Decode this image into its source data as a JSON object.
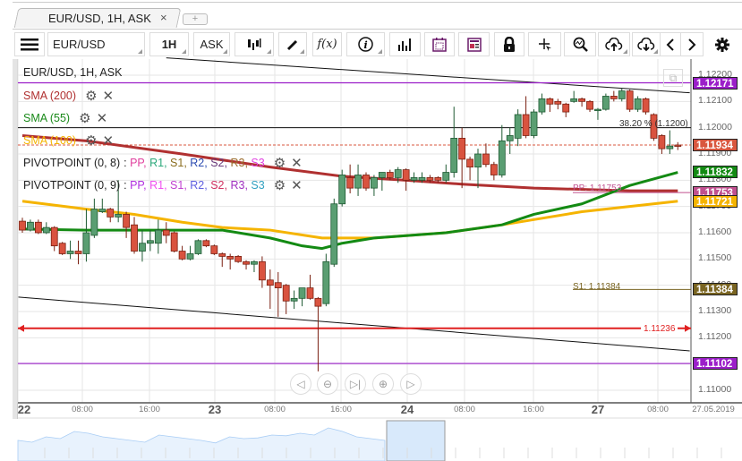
{
  "tab": {
    "title": "EUR/USD, 1H, ASK",
    "close": "×",
    "add": "+"
  },
  "toolbar": {
    "symbol": "EUR/USD",
    "timeframe": "1H",
    "price_type": "ASK",
    "fx": "f(x)",
    "icons": [
      "menu-icon",
      "candlestick-icon",
      "pencil-icon",
      "function-icon",
      "info-icon",
      "bar-chart-icon",
      "calendar-icon",
      "news-icon",
      "lock-icon",
      "crosshair-icon",
      "zoom-chart-icon",
      "upload-icon",
      "download-icon",
      "chevron-left-icon",
      "chevron-right-icon",
      "gear-icon"
    ]
  },
  "legend": {
    "title": "EUR/USD, 1H, ASK",
    "sma200": {
      "label": "SMA (200)",
      "color": "#b03030"
    },
    "sma55": {
      "label": "SMA (55)",
      "color": "#1a8a1a"
    },
    "sma100": {
      "label": "SMA (100)",
      "color": "#f5b400"
    },
    "pivot8": {
      "label": "PIVOTPOINT (0, 8)",
      "items": [
        {
          "t": "PP",
          "c": "#e0409e"
        },
        {
          "t": "R1",
          "c": "#2aa87a"
        },
        {
          "t": "S1",
          "c": "#8a6d1e"
        },
        {
          "t": "R2",
          "c": "#2a4ab0"
        },
        {
          "t": "S2",
          "c": "#6a3a7a"
        },
        {
          "t": "R3",
          "c": "#9a6a2a"
        },
        {
          "t": "S3",
          "c": "#e040e0"
        }
      ]
    },
    "pivot9": {
      "label": "PIVOTPOINT (0, 9)",
      "items": [
        {
          "t": "PP",
          "c": "#b030e0"
        },
        {
          "t": "R1",
          "c": "#f050f0"
        },
        {
          "t": "S1",
          "c": "#c040d0"
        },
        {
          "t": "R2",
          "c": "#6060e0"
        },
        {
          "t": "S2",
          "c": "#d03060"
        },
        {
          "t": "R3",
          "c": "#a030c0"
        },
        {
          "t": "S3",
          "c": "#30a0c0"
        }
      ]
    }
  },
  "price_axis": [
    "1.12200",
    "1.12100",
    "1.12000",
    "1.11900",
    "1.11800",
    "1.11700",
    "1.11600",
    "1.11500",
    "1.11400",
    "1.11300",
    "1.11200",
    "1.11100",
    "1.11000"
  ],
  "price_labels": [
    {
      "value": "1.12171",
      "color": "#9b1fc9"
    },
    {
      "value": "1.11934",
      "color": "#d9573f"
    },
    {
      "value": "1.11832",
      "color": "#138a13"
    },
    {
      "value": "1.11753",
      "color": "#c0508f"
    },
    {
      "value": "1.11721",
      "color": "#f5b400"
    },
    {
      "value": "1.11384",
      "color": "#7a6522"
    },
    {
      "value": "1.11102",
      "color": "#9b1fc9"
    }
  ],
  "annotations": {
    "fib": "38.20 % (1.1200)",
    "fib_price": 1.12,
    "pp": "PP: 1.11753",
    "s1": "S1: 1.11384",
    "alert": "1.11236",
    "alert_price": 1.11236,
    "last_price": 1.11934
  },
  "time_axis": {
    "labels": [
      "22",
      "08:00",
      "16:00",
      "23",
      "08:00",
      "16:00",
      "24",
      "08:00",
      "16:00",
      "27",
      "08:00"
    ],
    "date": "27.05.2019"
  },
  "colors": {
    "bull": "#5a9e72",
    "bear": "#d9533f"
  },
  "chart_data": {
    "type": "candlestick",
    "symbol": "EUR/USD",
    "interval": "1H",
    "ylim": [
      1.1095,
      1.1228
    ],
    "ohlc": [
      [
        1.11644,
        1.11657,
        1.116,
        1.1161
      ],
      [
        1.1161,
        1.1165,
        1.11605,
        1.1164
      ],
      [
        1.1164,
        1.1165,
        1.11595,
        1.116
      ],
      [
        1.116,
        1.1164,
        1.11595,
        1.1162
      ],
      [
        1.1162,
        1.11625,
        1.1153,
        1.1155
      ],
      [
        1.1156,
        1.11565,
        1.11515,
        1.1152
      ],
      [
        1.1152,
        1.1157,
        1.115,
        1.1153
      ],
      [
        1.1153,
        1.1157,
        1.1148,
        1.1152
      ],
      [
        1.1152,
        1.1169,
        1.1149,
        1.116
      ],
      [
        1.1159,
        1.1173,
        1.1158,
        1.1169
      ],
      [
        1.1168,
        1.1173,
        1.11675,
        1.1169
      ],
      [
        1.1169,
        1.11695,
        1.1164,
        1.1166
      ],
      [
        1.1166,
        1.118,
        1.1164,
        1.1167
      ],
      [
        1.1167,
        1.1168,
        1.1158,
        1.1162
      ],
      [
        1.1163,
        1.1166,
        1.1152,
        1.1153
      ],
      [
        1.1153,
        1.1161,
        1.1149,
        1.1156
      ],
      [
        1.1156,
        1.1161,
        1.1153,
        1.1157
      ],
      [
        1.1156,
        1.1165,
        1.1152,
        1.1161
      ],
      [
        1.1161,
        1.1164,
        1.1156,
        1.1159
      ],
      [
        1.116,
        1.11605,
        1.11525,
        1.1153
      ],
      [
        1.1153,
        1.1155,
        1.11495,
        1.115
      ],
      [
        1.115,
        1.1155,
        1.11495,
        1.1152
      ],
      [
        1.1152,
        1.11575,
        1.11515,
        1.1157
      ],
      [
        1.1157,
        1.11575,
        1.11545,
        1.1155
      ],
      [
        1.1155,
        1.11555,
        1.11515,
        1.1152
      ],
      [
        1.1152,
        1.11525,
        1.1147,
        1.1151
      ],
      [
        1.1151,
        1.1152,
        1.1146,
        1.115
      ],
      [
        1.1151,
        1.11515,
        1.11485,
        1.1149
      ],
      [
        1.1149,
        1.11495,
        1.1146,
        1.1148
      ],
      [
        1.1148,
        1.11495,
        1.1145,
        1.1149
      ],
      [
        1.1149,
        1.1151,
        1.1139,
        1.1142
      ],
      [
        1.1142,
        1.1146,
        1.1131,
        1.114
      ],
      [
        1.1141,
        1.1145,
        1.1128,
        1.1139
      ],
      [
        1.114,
        1.11405,
        1.1129,
        1.1134
      ],
      [
        1.1134,
        1.1138,
        1.1131,
        1.1135
      ],
      [
        1.1135,
        1.1139,
        1.1132,
        1.1139
      ],
      [
        1.1139,
        1.1144,
        1.11345,
        1.1135
      ],
      [
        1.1135,
        1.11355,
        1.11072,
        1.1132
      ],
      [
        1.1133,
        1.1152,
        1.1132,
        1.1149
      ],
      [
        1.1148,
        1.1173,
        1.1147,
        1.1171
      ],
      [
        1.1171,
        1.1184,
        1.117,
        1.1182
      ],
      [
        1.1181,
        1.1186,
        1.1175,
        1.1177
      ],
      [
        1.1177,
        1.1186,
        1.1174,
        1.1182
      ],
      [
        1.1182,
        1.1183,
        1.1176,
        1.1177
      ],
      [
        1.1177,
        1.1182,
        1.1174,
        1.1181
      ],
      [
        1.1181,
        1.1183,
        1.1176,
        1.1183
      ],
      [
        1.1183,
        1.1184,
        1.118,
        1.1181
      ],
      [
        1.1181,
        1.1185,
        1.1179,
        1.1184
      ],
      [
        1.1184,
        1.11845,
        1.1176,
        1.118
      ],
      [
        1.118,
        1.1183,
        1.1179,
        1.1181
      ],
      [
        1.118,
        1.1183,
        1.1179,
        1.1181
      ],
      [
        1.1181,
        1.1182,
        1.1179,
        1.118
      ],
      [
        1.1181,
        1.11815,
        1.1179,
        1.118
      ],
      [
        1.118,
        1.1186,
        1.1179,
        1.1183
      ],
      [
        1.1183,
        1.1208,
        1.1181,
        1.1196
      ],
      [
        1.1196,
        1.12,
        1.1177,
        1.1188
      ],
      [
        1.1188,
        1.1189,
        1.118,
        1.1185
      ],
      [
        1.1185,
        1.1192,
        1.1177,
        1.119
      ],
      [
        1.119,
        1.1194,
        1.1185,
        1.1186
      ],
      [
        1.1186,
        1.1187,
        1.118,
        1.1182
      ],
      [
        1.1182,
        1.1201,
        1.1181,
        1.1195
      ],
      [
        1.1195,
        1.12,
        1.119,
        1.1197
      ],
      [
        1.1196,
        1.1207,
        1.1193,
        1.1205
      ],
      [
        1.1205,
        1.1212,
        1.1196,
        1.1197
      ],
      [
        1.1197,
        1.1207,
        1.1196,
        1.1206
      ],
      [
        1.1206,
        1.1213,
        1.1205,
        1.1211
      ],
      [
        1.1211,
        1.12115,
        1.1206,
        1.1209
      ],
      [
        1.121,
        1.1211,
        1.1207,
        1.1209
      ],
      [
        1.1209,
        1.12095,
        1.1204,
        1.1206
      ],
      [
        1.121,
        1.1214,
        1.12095,
        1.1211
      ],
      [
        1.1211,
        1.12115,
        1.1208,
        1.121
      ],
      [
        1.121,
        1.12105,
        1.1206,
        1.1207
      ],
      [
        1.1207,
        1.12075,
        1.1203,
        1.1207
      ],
      [
        1.1207,
        1.1213,
        1.12065,
        1.1212
      ],
      [
        1.1212,
        1.1214,
        1.121,
        1.1211
      ],
      [
        1.1211,
        1.1215,
        1.121,
        1.1214
      ],
      [
        1.1214,
        1.12145,
        1.1206,
        1.1207
      ],
      [
        1.1207,
        1.1212,
        1.1206,
        1.1211
      ],
      [
        1.1211,
        1.12115,
        1.1205,
        1.1206
      ],
      [
        1.1205,
        1.12055,
        1.1195,
        1.1196
      ],
      [
        1.1197,
        1.11975,
        1.119,
        1.1192
      ],
      [
        1.1192,
        1.1199,
        1.119,
        1.1193
      ],
      [
        1.11934,
        1.11945,
        1.11915,
        1.1193
      ]
    ],
    "sma200": [
      [
        0,
        1.1197
      ],
      [
        8,
        1.1195
      ],
      [
        20,
        1.119
      ],
      [
        31,
        1.1185
      ],
      [
        40,
        1.11815
      ],
      [
        48,
        1.118
      ],
      [
        55,
        1.11785
      ],
      [
        64,
        1.1177
      ],
      [
        76,
        1.1176
      ],
      [
        82,
        1.1176
      ]
    ],
    "sma55": [
      [
        0,
        1.11614
      ],
      [
        8,
        1.1161
      ],
      [
        14,
        1.1161
      ],
      [
        20,
        1.1161
      ],
      [
        25,
        1.1161
      ],
      [
        31,
        1.1158
      ],
      [
        35,
        1.1155
      ],
      [
        37.5,
        1.1154
      ],
      [
        40,
        1.1156
      ],
      [
        44,
        1.1158
      ],
      [
        53,
        1.116
      ],
      [
        60,
        1.1163
      ],
      [
        64,
        1.1167
      ],
      [
        70,
        1.1171
      ],
      [
        76,
        1.1178
      ],
      [
        82,
        1.1183
      ]
    ],
    "sma100": [
      [
        0,
        1.1172
      ],
      [
        8,
        1.1169
      ],
      [
        14,
        1.1167
      ],
      [
        20,
        1.1164
      ],
      [
        25,
        1.1162
      ],
      [
        31,
        1.1161
      ],
      [
        37.5,
        1.1158
      ],
      [
        44,
        1.1158
      ],
      [
        53,
        1.116
      ],
      [
        60,
        1.1163
      ],
      [
        64,
        1.1165
      ],
      [
        70,
        1.1168
      ],
      [
        76,
        1.117
      ],
      [
        82,
        1.1172
      ]
    ],
    "levels": {
      "r_purple": 1.12171,
      "s_purple": 1.11102,
      "pp": 1.11753,
      "s1": 1.11384
    },
    "trendlines": [
      {
        "from": [
          18,
          1.12266
        ],
        "to": [
          83.5,
          1.12133
        ]
      },
      {
        "from": [
          -0.5,
          1.11355
        ],
        "to": [
          83.5,
          1.1115
        ]
      }
    ],
    "navigator": [
      0.55,
      0.6,
      0.45,
      0.5,
      0.3,
      0.35,
      0.45,
      0.5,
      0.55,
      0.6,
      0.4,
      0.45,
      0.5,
      0.55,
      0.62,
      0.45,
      0.5,
      0.48,
      0.4,
      0.42,
      0.35,
      0.4,
      0.2,
      0.3,
      0.45,
      0.5,
      0.55
    ]
  },
  "nav_buttons": [
    "scroll-left",
    "zoom-out",
    "go-to-latest",
    "zoom-in",
    "scroll-right"
  ]
}
